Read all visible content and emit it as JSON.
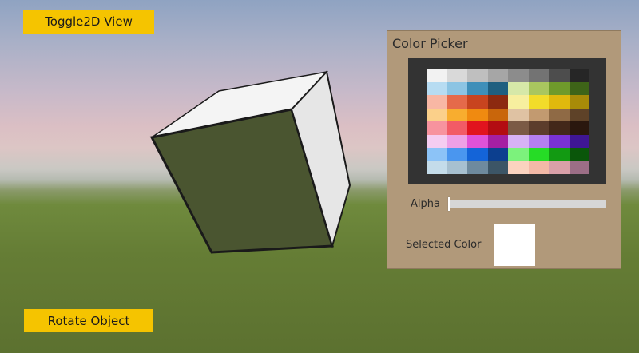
{
  "buttons": {
    "toggle_label": "Toggle2D View",
    "rotate_label": "Rotate Object"
  },
  "color_picker": {
    "title": "Color Picker",
    "alpha_label": "Alpha",
    "alpha_value": 0,
    "selected_label": "Selected Color",
    "selected_color": "#ffffff",
    "palette": [
      [
        "#f2f2f2",
        "#d9d9d9",
        "#bfbfbf",
        "#a6a6a6",
        "#8c8c8c",
        "#737373",
        "#4d4d4d",
        "#262626"
      ],
      [
        "#b7dcf2",
        "#8cc4e3",
        "#3f8fb9",
        "#1f5f80",
        "#d6e8a8",
        "#a9c65f",
        "#6f9a2b",
        "#3e6418"
      ],
      [
        "#f8b7a4",
        "#e56a4a",
        "#c8441f",
        "#8c2a10",
        "#f7ef9f",
        "#f2dc2a",
        "#e0b90d",
        "#a88b08"
      ],
      [
        "#fbd08a",
        "#f8ad2f",
        "#f08a10",
        "#c9660b",
        "#dfc2a3",
        "#c29a70",
        "#8f6a45",
        "#5e4228"
      ],
      [
        "#f7939e",
        "#f25b66",
        "#e1141e",
        "#b30c12",
        "#7b5a45",
        "#5c3d2c",
        "#43281a",
        "#2a170e"
      ],
      [
        "#f5cdf1",
        "#eea0e6",
        "#e052d8",
        "#a51fa3",
        "#d7b2f5",
        "#b57ff0",
        "#7a32d4",
        "#3f1694"
      ],
      [
        "#8cc3f7",
        "#4a96ef",
        "#1464d8",
        "#0c3f8f",
        "#7cf27c",
        "#26dc26",
        "#129a12",
        "#0a560a"
      ],
      [
        "#c4dcea",
        "#a7c0d0",
        "#6e8a9e",
        "#3c5566",
        "#fbd3bf",
        "#f3b9a7",
        "#d9a0a8",
        "#9c6e86"
      ]
    ]
  }
}
